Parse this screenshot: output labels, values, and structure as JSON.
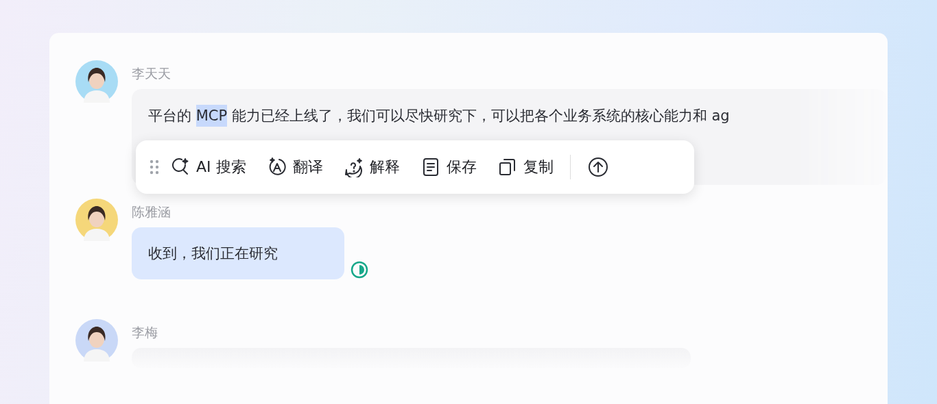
{
  "messages": [
    {
      "sender": "李天天",
      "color": "#a8dcf5",
      "kind": "long",
      "parts": [
        {
          "text": "平台的 ",
          "selected": false
        },
        {
          "text": "MCP",
          "selected": true
        },
        {
          "text": " 能力已经上线了，我们可以尽快研究下，可以把各个业务系统的核心能力和 ag",
          "selected": false
        }
      ]
    },
    {
      "sender": "陈雅涵",
      "color": "#f5d77a",
      "kind": "tinted",
      "read": true,
      "parts": [
        {
          "text": "收到，我们正在研究",
          "selected": false
        }
      ]
    },
    {
      "sender": "李梅",
      "color": "#c9d8f7",
      "kind": "empty"
    }
  ],
  "toolbar": {
    "items": [
      {
        "kind": "ai-search",
        "label": "AI 搜索"
      },
      {
        "kind": "translate",
        "label": "翻译"
      },
      {
        "kind": "explain",
        "label": "解释"
      },
      {
        "kind": "save",
        "label": "保存"
      },
      {
        "kind": "copy",
        "label": "复制"
      },
      {
        "kind": "send"
      }
    ]
  }
}
